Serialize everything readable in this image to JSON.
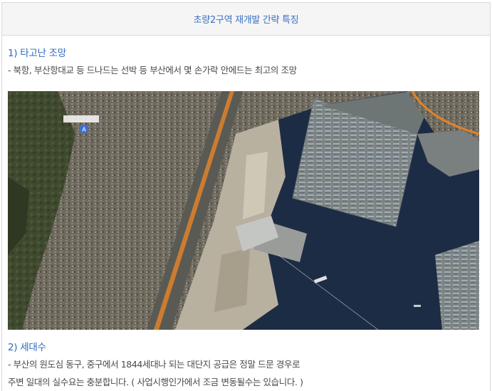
{
  "header": {
    "title": "초량2구역 재개발 간략 특징"
  },
  "sections": [
    {
      "heading": "1) 타고난 조망",
      "lines": [
        "- 북항, 부산항대교 등 드나드는 선박 등 부산에서 몇 손가락 안에드는 최고의 조망"
      ]
    },
    {
      "heading": "2) 세대수",
      "lines": [
        "- 부산의 원도심 동구, 중구에서 1844세대나 되는 대단지 공급은 정말 드문 경우로",
        "주변 일대의 실수요는 충분합니다. ( 사업시행인가에서 조금 변동될수는 있습니다. )"
      ]
    }
  ],
  "map": {
    "marker_letter": "A",
    "colors": {
      "water": "#1d2c45",
      "city": "#6f6a5f",
      "green": "#3f4a2e",
      "reclaimed": "#b8b1a0",
      "road": "#e0832a",
      "pier": "#9a9c9a"
    }
  }
}
